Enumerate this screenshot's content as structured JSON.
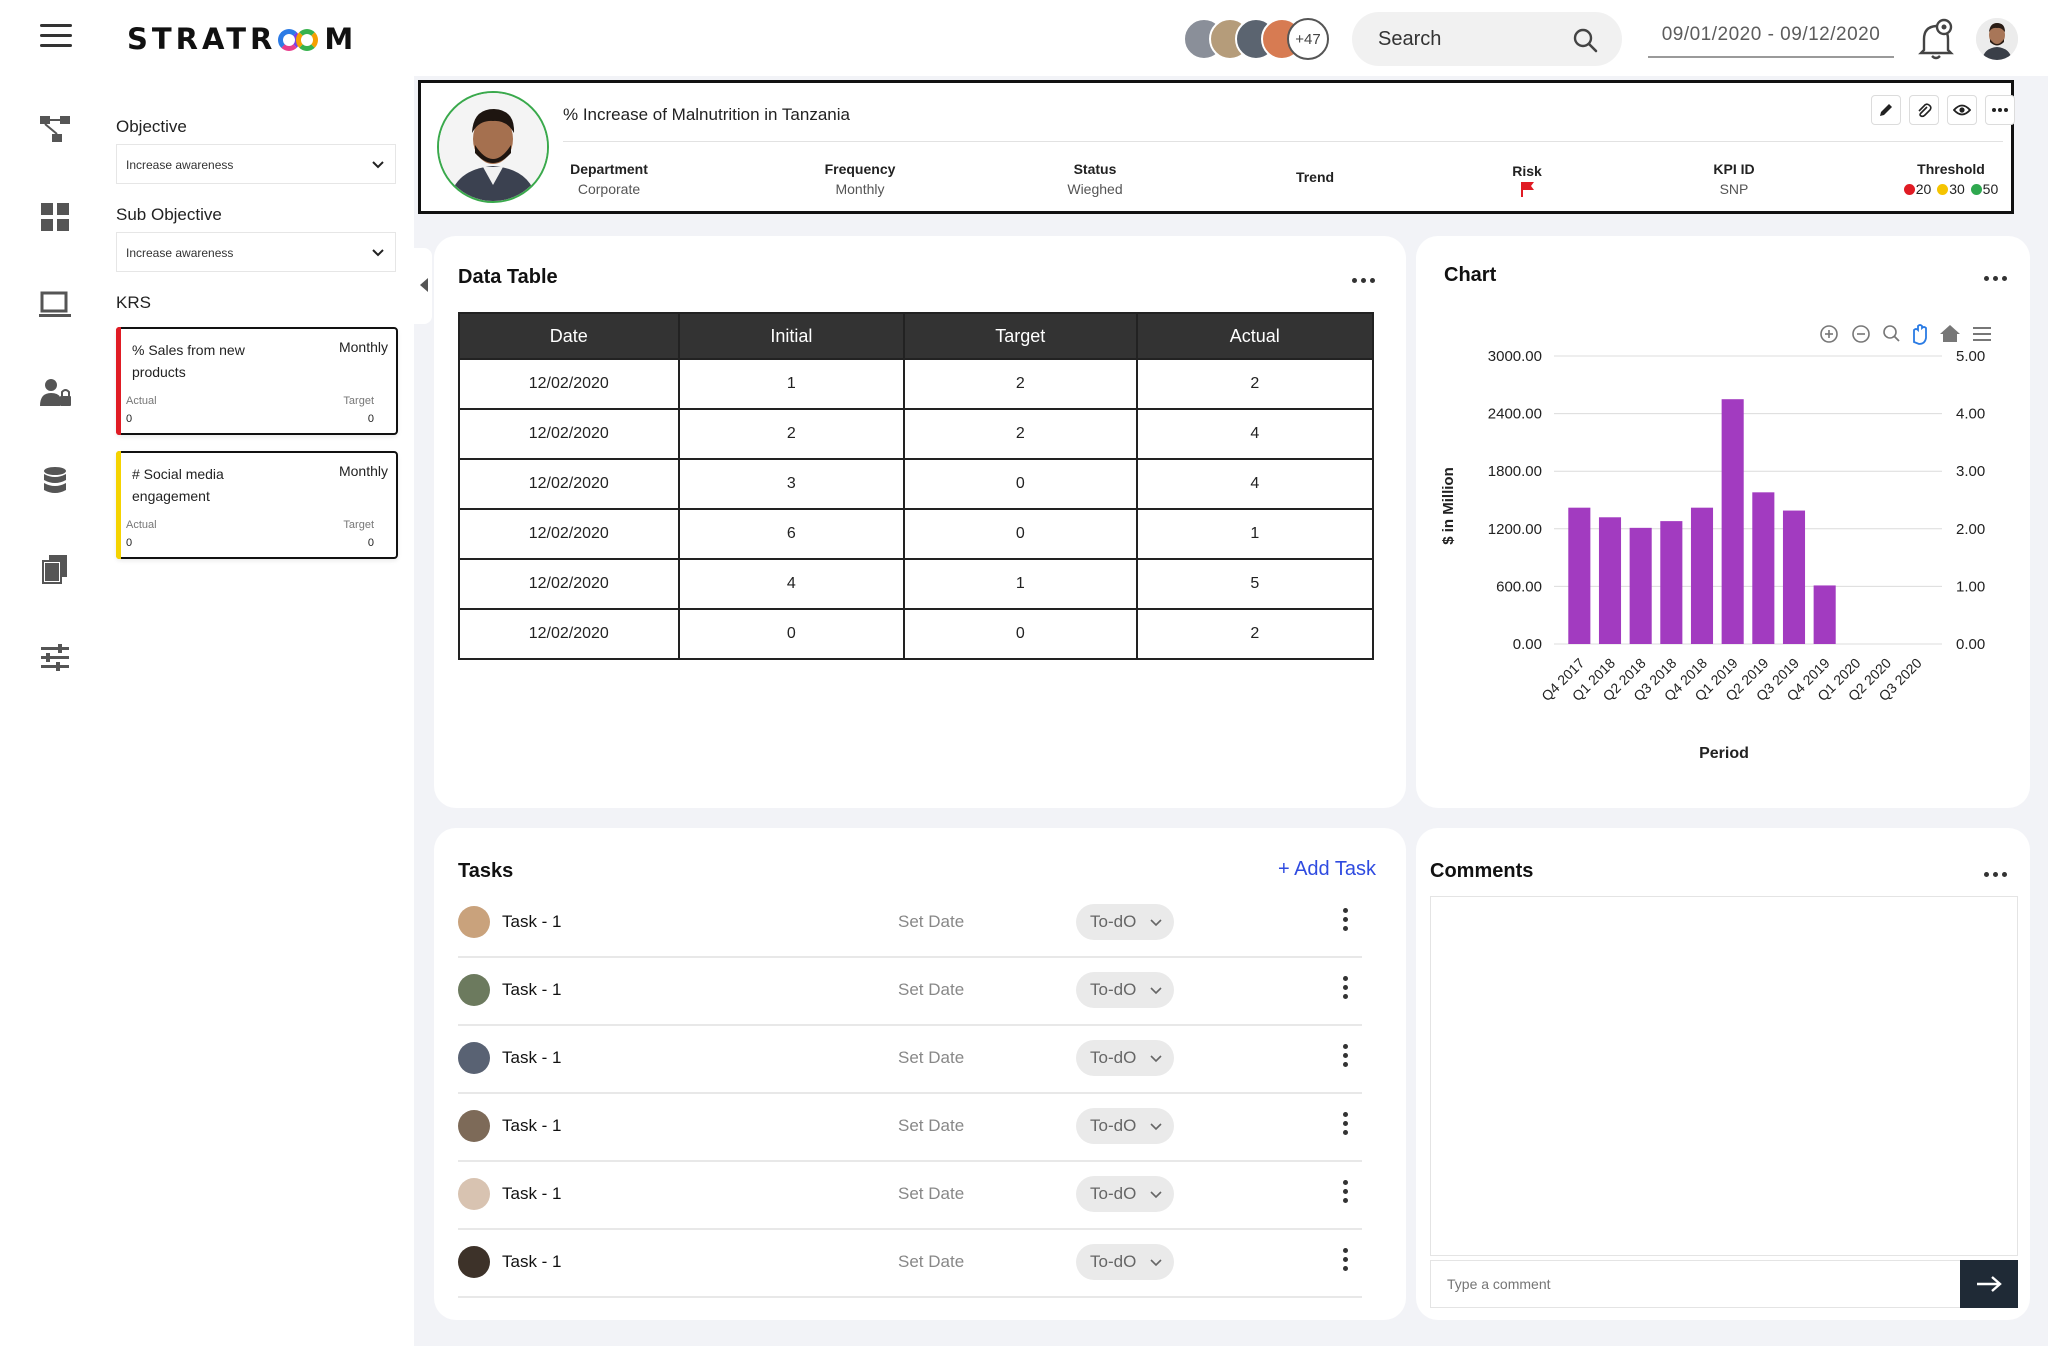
{
  "app": {
    "logo_left": "STRATR",
    "logo_right": "M"
  },
  "topbar": {
    "team_more": "+47",
    "search_label": "Search",
    "date_range": "09/01/2020 - 09/12/2020"
  },
  "filters": {
    "objective_label": "Objective",
    "objective_value": "Increase awareness",
    "sub_objective_label": "Sub Objective",
    "sub_objective_value": "Increase awareness",
    "krs_label": "KRS",
    "krs": [
      {
        "name": "% Sales from new products",
        "frequency": "Monthly",
        "actual_label": "Actual",
        "actual": "0",
        "target_label": "Target",
        "target": "0",
        "color": "#e01b24"
      },
      {
        "name": "# Social media engagement",
        "frequency": "Monthly",
        "actual_label": "Actual",
        "actual": "0",
        "target_label": "Target",
        "target": "0",
        "color": "#f5d300"
      }
    ]
  },
  "kpi": {
    "title": "% Increase of Malnutrition in Tanzania",
    "department_label": "Department",
    "department": "Corporate",
    "frequency_label": "Frequency",
    "frequency": "Monthly",
    "status_label": "Status",
    "status": "Wieghed",
    "trend_label": "Trend",
    "risk_label": "Risk",
    "kpi_id_label": "KPI ID",
    "kpi_id": "SNP",
    "threshold_label": "Threshold",
    "thresholds": [
      {
        "value": "20",
        "color": "#e01b24"
      },
      {
        "value": "30",
        "color": "#f5c400"
      },
      {
        "value": "50",
        "color": "#2fa84f"
      }
    ]
  },
  "data_table": {
    "title": "Data Table",
    "columns": [
      "Date",
      "Initial",
      "Target",
      "Actual"
    ],
    "rows": [
      [
        "12/02/2020",
        "1",
        "2",
        "2"
      ],
      [
        "12/02/2020",
        "2",
        "2",
        "4"
      ],
      [
        "12/02/2020",
        "3",
        "0",
        "4"
      ],
      [
        "12/02/2020",
        "6",
        "0",
        "1"
      ],
      [
        "12/02/2020",
        "4",
        "1",
        "5"
      ],
      [
        "12/02/2020",
        "0",
        "0",
        "2"
      ]
    ]
  },
  "chart_card": {
    "title": "Chart"
  },
  "chart_data": {
    "type": "bar",
    "title": "",
    "xlabel": "Period",
    "ylabel": "$ in Million",
    "categories": [
      "Q4 2017",
      "Q1 2018",
      "Q2 2018",
      "Q3 2018",
      "Q4 2018",
      "Q1 2019",
      "Q2 2019",
      "Q3 2019",
      "Q4 2019",
      "Q1 2020",
      "Q2 2020",
      "Q3 2020"
    ],
    "values": [
      1420,
      1320,
      1210,
      1280,
      1420,
      2550,
      1580,
      1390,
      610,
      null,
      null,
      null
    ],
    "ylim": [
      0,
      3000
    ],
    "y_ticks": [
      "0.00",
      "600.00",
      "1200.00",
      "1800.00",
      "2400.00",
      "3000.00"
    ],
    "y2_ticks": [
      "0.00",
      "1.00",
      "2.00",
      "3.00",
      "4.00",
      "5.00"
    ],
    "bar_color": "#a23bc0",
    "grid": true
  },
  "tasks": {
    "title": "Tasks",
    "add_label": "+ Add Task",
    "items": [
      {
        "name": "Task - 1",
        "date": "Set Date",
        "status": "To-dO"
      },
      {
        "name": "Task - 1",
        "date": "Set Date",
        "status": "To-dO"
      },
      {
        "name": "Task - 1",
        "date": "Set Date",
        "status": "To-dO"
      },
      {
        "name": "Task - 1",
        "date": "Set Date",
        "status": "To-dO"
      },
      {
        "name": "Task - 1",
        "date": "Set Date",
        "status": "To-dO"
      },
      {
        "name": "Task - 1",
        "date": "Set Date",
        "status": "To-dO"
      }
    ]
  },
  "comments": {
    "title": "Comments",
    "placeholder": "Type a comment"
  }
}
